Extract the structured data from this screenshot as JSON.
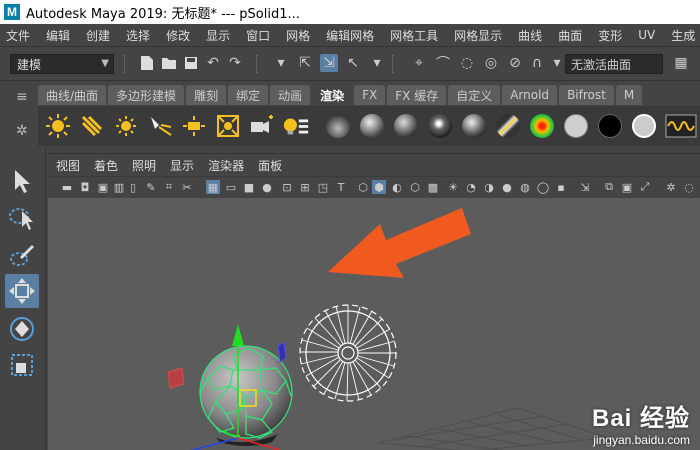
{
  "window": {
    "app_icon_letter": "M",
    "title": "Autodesk Maya 2019: 无标题*    ---    pSolid1..."
  },
  "menubar": {
    "items": [
      "文件",
      "编辑",
      "创建",
      "选择",
      "修改",
      "显示",
      "窗口",
      "网格",
      "编辑网格",
      "网格工具",
      "网格显示",
      "曲线",
      "曲面",
      "变形",
      "UV",
      "生成"
    ]
  },
  "statusline": {
    "mode": "建模",
    "snap_field_placeholder": "无激活曲面"
  },
  "shelf": {
    "tabs": [
      "曲线/曲面",
      "多边形建模",
      "雕刻",
      "绑定",
      "动画",
      "渲染",
      "FX",
      "FX 缓存",
      "自定义",
      "Arnold",
      "Bifrost",
      "M"
    ],
    "active_tab": "渲染"
  },
  "viewport": {
    "menu": [
      "视图",
      "着色",
      "照明",
      "显示",
      "渲染器",
      "面板"
    ]
  },
  "watermark": {
    "brand": "Bai 经验",
    "url": "jingyan.baidu.com"
  },
  "colors": {
    "arrow": "#f05a1e",
    "selection_wire": "#36e07a",
    "axis_y": "#22dd22",
    "axis_x": "#ee2222",
    "axis_z": "#2244ee",
    "highlight": "#5a7fa3"
  }
}
